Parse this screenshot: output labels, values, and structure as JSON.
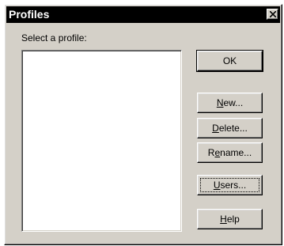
{
  "window": {
    "title": "Profiles",
    "close_glyph": "close-icon"
  },
  "main": {
    "prompt": "Select a profile:",
    "profiles": []
  },
  "buttons": {
    "ok": {
      "label": "OK",
      "mnemonic": ""
    },
    "new": {
      "mnemonic": "N",
      "rest": "ew..."
    },
    "delete": {
      "mnemonic": "D",
      "rest": "elete..."
    },
    "rename": {
      "prefix": "R",
      "mnemonic": "e",
      "rest": "name..."
    },
    "users": {
      "mnemonic": "U",
      "rest": "sers..."
    },
    "help": {
      "mnemonic": "H",
      "rest": "elp"
    }
  },
  "colors": {
    "face": "#d4d0c8",
    "titlebar": "#000000",
    "title_text": "#ffffff",
    "list_bg": "#ffffff"
  }
}
